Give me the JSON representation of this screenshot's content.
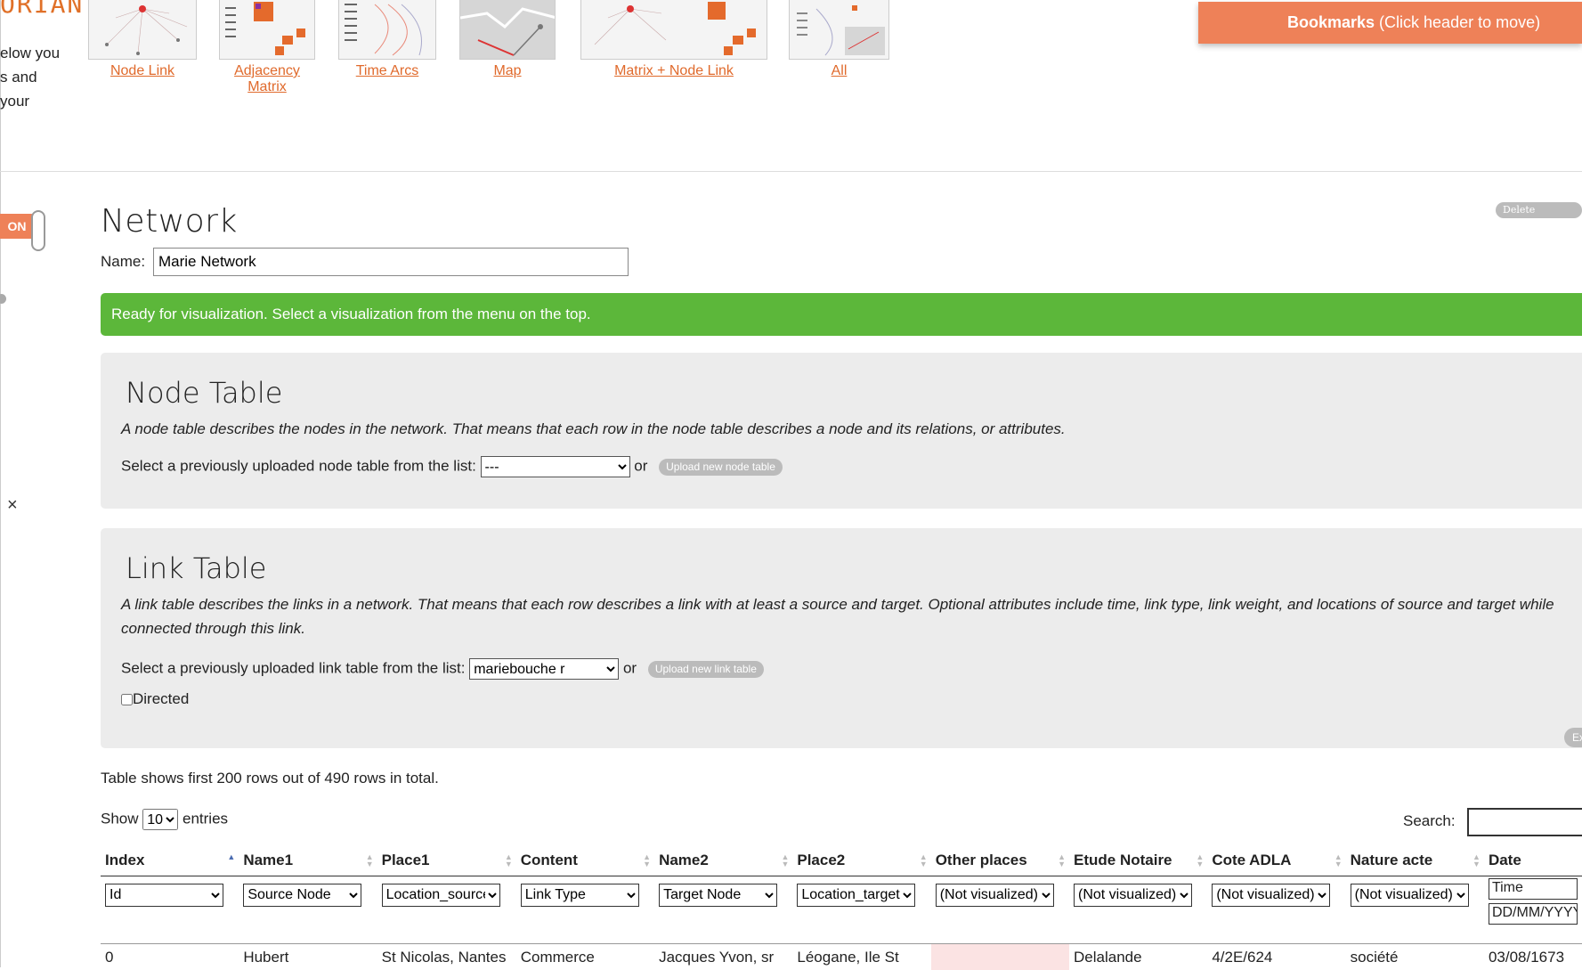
{
  "app": {
    "logo_text": "ORIAN",
    "intro_lines": [
      "elow you",
      "s and",
      "your"
    ]
  },
  "visualizations": [
    {
      "label": "Node Link",
      "thumb": "node-link-thumbnail"
    },
    {
      "label": "Adjacency Matrix",
      "thumb": "adjacency-matrix-thumbnail"
    },
    {
      "label": "Time Arcs",
      "thumb": "time-arcs-thumbnail"
    },
    {
      "label": "Map",
      "thumb": "map-thumbnail"
    },
    {
      "label": "Matrix + Node Link",
      "thumb": "matrix-node-link-thumbnail"
    },
    {
      "label": "All",
      "thumb": "all-thumbnail"
    }
  ],
  "bookmarks": {
    "bold": "Bookmarks",
    "rest": " (Click header to move)"
  },
  "toggle": {
    "label": "ON"
  },
  "close_symbol": "×",
  "network": {
    "title": "Network",
    "delete_label": "Delete Network",
    "name_label": "Name:",
    "name_value": "Marie Network",
    "status": "Ready for visualization. Select a visualization from the menu on the top."
  },
  "node_table": {
    "title": "Node Table",
    "description": "A node table describes the nodes in the network. That means that each row in the node table describes a node and its relations, or attributes.",
    "select_label": "Select a previously uploaded node table from the list:",
    "selected": "---",
    "or": "or",
    "upload_label": "Upload new node table"
  },
  "link_table": {
    "title": "Link Table",
    "description": "A link table describes the links in a network. That means that each row describes a link with at least a source and target. Optional attributes include time, link type, link weight, and locations of source and target while connected through this link.",
    "select_label": "Select a previously uploaded link table from the list:",
    "selected": "mariebouche r",
    "or": "or",
    "upload_label": "Upload new link table",
    "directed_label": "Directed",
    "ex_label": "Ex"
  },
  "table_info": {
    "rows_text": "Table shows first 200 rows out of 490 rows in total.",
    "show_label": "Show",
    "entries_value": "10",
    "entries_label": "entries",
    "search_label": "Search:"
  },
  "columns": [
    {
      "header": "Index",
      "filter": "Id"
    },
    {
      "header": "Name1",
      "filter": "Source Node"
    },
    {
      "header": "Place1",
      "filter": "Location_source"
    },
    {
      "header": "Content",
      "filter": "Link Type"
    },
    {
      "header": "Name2",
      "filter": "Target Node"
    },
    {
      "header": "Place2",
      "filter": "Location_target"
    },
    {
      "header": "Other places",
      "filter": "(Not visualized)"
    },
    {
      "header": "Etude Notaire",
      "filter": "(Not visualized)"
    },
    {
      "header": "Cote ADLA",
      "filter": "(Not visualized)"
    },
    {
      "header": "Nature acte",
      "filter": "(Not visualized)"
    },
    {
      "header": "Date",
      "filter": "Time",
      "format": "DD/MM/YYYY"
    }
  ],
  "rows": [
    [
      "0",
      "Hubert",
      "St Nicolas, Nantes",
      "Commerce",
      "Jacques Yvon, sr",
      "Léogane, Ile St",
      "",
      "Delalande",
      "4/2E/624",
      "société",
      "03/08/1673"
    ]
  ]
}
